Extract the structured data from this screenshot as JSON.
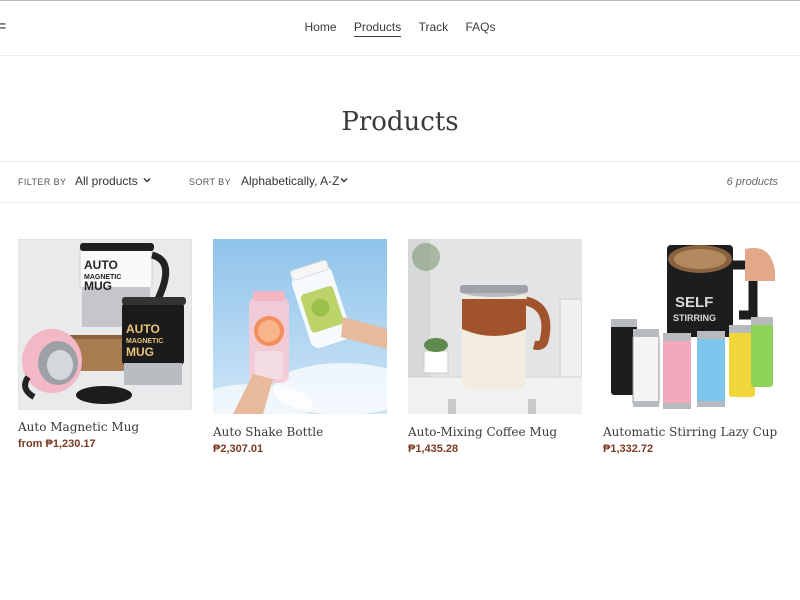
{
  "nav": {
    "items": [
      {
        "label": "Home"
      },
      {
        "label": "Products",
        "active": true
      },
      {
        "label": "Track"
      },
      {
        "label": "FAQs"
      }
    ]
  },
  "page": {
    "title": "Products"
  },
  "filter": {
    "filter_label": "FILTER BY",
    "filter_value": "All products",
    "sort_label": "SORT BY",
    "sort_value": "Alphabetically, A-Z",
    "count": "6 products"
  },
  "products": [
    {
      "title": "Auto Magnetic Mug",
      "price": "from ₱1,230.17"
    },
    {
      "title": "Auto Shake Bottle",
      "price": "₱2,307.01"
    },
    {
      "title": "Auto-Mixing Coffee Mug",
      "price": "₱1,435.28"
    },
    {
      "title": "Automatic Stirring Lazy Cup",
      "price": "₱1,332.72"
    }
  ],
  "colors": {
    "accent": "#7a3b22",
    "text": "#3a3a3a"
  }
}
